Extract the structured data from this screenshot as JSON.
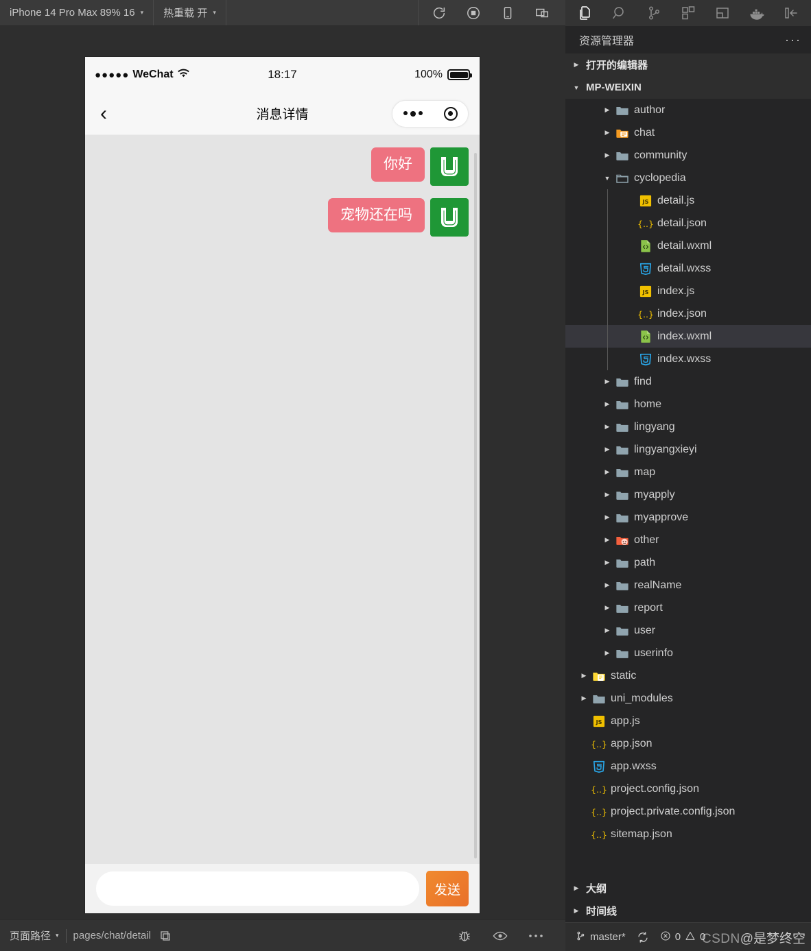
{
  "simulator": {
    "toolbar": {
      "device_label": "iPhone 14 Pro Max 89% 16",
      "hotreload_label": "热重载 开",
      "caret": "▾",
      "icons": [
        {
          "name": "refresh-icon"
        },
        {
          "name": "stop-record-icon"
        },
        {
          "name": "device-icon"
        },
        {
          "name": "multi-window-icon"
        }
      ]
    },
    "phone": {
      "status_bar": {
        "signal_dots": "●●●●●",
        "carrier": "WeChat",
        "time": "18:17",
        "battery_percent": "100%"
      },
      "nav_bar": {
        "back": "‹",
        "title": "消息详情"
      },
      "messages": [
        {
          "text": "你好",
          "avatar": "uni-app-logo"
        },
        {
          "text": "宠物还在吗",
          "avatar": "uni-app-logo"
        }
      ],
      "input": {
        "value": "",
        "placeholder": ""
      },
      "send_label": "发送"
    },
    "status_bar": {
      "page_path_label": "页面路径",
      "caret": "▾",
      "path_value": "pages/chat/detail",
      "icons": [
        {
          "name": "copy-icon"
        },
        {
          "name": "debug-bug-icon"
        },
        {
          "name": "eye-icon"
        },
        {
          "name": "more-icon"
        }
      ]
    }
  },
  "vscode": {
    "activity_bar": [
      {
        "name": "explorer-icon",
        "active": true
      },
      {
        "name": "search-icon",
        "active": false
      },
      {
        "name": "source-control-icon",
        "active": false
      },
      {
        "name": "extensions-icon",
        "active": false
      },
      {
        "name": "layout-panel-icon",
        "active": false
      },
      {
        "name": "docker-icon",
        "active": false
      },
      {
        "name": "collapse-sidebar-icon",
        "active": false
      }
    ],
    "panel_title": "资源管理器",
    "panel_more": "···",
    "sections": {
      "open_editors": "打开的编辑器",
      "workspace": "MP-WEIXIN",
      "outline": "大纲",
      "timeline": "时间线"
    },
    "tree": [
      {
        "label": "author",
        "type": "folder",
        "indent": 1,
        "expanded": false
      },
      {
        "label": "chat",
        "type": "folder-chat",
        "indent": 1,
        "expanded": false
      },
      {
        "label": "community",
        "type": "folder",
        "indent": 1,
        "expanded": false
      },
      {
        "label": "cyclopedia",
        "type": "folder-open",
        "indent": 1,
        "expanded": true
      },
      {
        "label": "detail.js",
        "type": "js",
        "indent": 2
      },
      {
        "label": "detail.json",
        "type": "json",
        "indent": 2
      },
      {
        "label": "detail.wxml",
        "type": "wxml",
        "indent": 2
      },
      {
        "label": "detail.wxss",
        "type": "wxss",
        "indent": 2
      },
      {
        "label": "index.js",
        "type": "js",
        "indent": 2
      },
      {
        "label": "index.json",
        "type": "json",
        "indent": 2
      },
      {
        "label": "index.wxml",
        "type": "wxml",
        "indent": 2,
        "selected": true
      },
      {
        "label": "index.wxss",
        "type": "wxss",
        "indent": 2
      },
      {
        "label": "find",
        "type": "folder",
        "indent": 1,
        "expanded": false
      },
      {
        "label": "home",
        "type": "folder",
        "indent": 1,
        "expanded": false
      },
      {
        "label": "lingyang",
        "type": "folder",
        "indent": 1,
        "expanded": false
      },
      {
        "label": "lingyangxieyi",
        "type": "folder",
        "indent": 1,
        "expanded": false
      },
      {
        "label": "map",
        "type": "folder",
        "indent": 1,
        "expanded": false
      },
      {
        "label": "myapply",
        "type": "folder",
        "indent": 1,
        "expanded": false
      },
      {
        "label": "myapprove",
        "type": "folder",
        "indent": 1,
        "expanded": false
      },
      {
        "label": "other",
        "type": "folder-other",
        "indent": 1,
        "expanded": false
      },
      {
        "label": "path",
        "type": "folder",
        "indent": 1,
        "expanded": false
      },
      {
        "label": "realName",
        "type": "folder",
        "indent": 1,
        "expanded": false
      },
      {
        "label": "report",
        "type": "folder",
        "indent": 1,
        "expanded": false
      },
      {
        "label": "user",
        "type": "folder",
        "indent": 1,
        "expanded": false
      },
      {
        "label": "userinfo",
        "type": "folder",
        "indent": 1,
        "expanded": false
      },
      {
        "label": "static",
        "type": "folder-static",
        "indent": 0,
        "expanded": false
      },
      {
        "label": "uni_modules",
        "type": "folder",
        "indent": 0,
        "expanded": false
      },
      {
        "label": "app.js",
        "type": "js",
        "indent": 0
      },
      {
        "label": "app.json",
        "type": "json",
        "indent": 0
      },
      {
        "label": "app.wxss",
        "type": "wxss",
        "indent": 0
      },
      {
        "label": "project.config.json",
        "type": "json",
        "indent": 0
      },
      {
        "label": "project.private.config.json",
        "type": "json",
        "indent": 0
      },
      {
        "label": "sitemap.json",
        "type": "json",
        "indent": 0
      }
    ],
    "status_bar": {
      "branch": "master*",
      "sync_icon": "sync-icon",
      "error_icon": "error-icon",
      "errors": "0",
      "warning_icon": "warning-icon",
      "warnings": "0"
    },
    "watermark": {
      "csdn": "CSDN",
      "author": "@是梦终空"
    }
  },
  "colors": {
    "bubble": "#ee7280",
    "avatar": "#1f9736",
    "send": "#ea742a",
    "selection": "#37373d",
    "activity_bar": "#333333",
    "sidebar": "#252526"
  }
}
